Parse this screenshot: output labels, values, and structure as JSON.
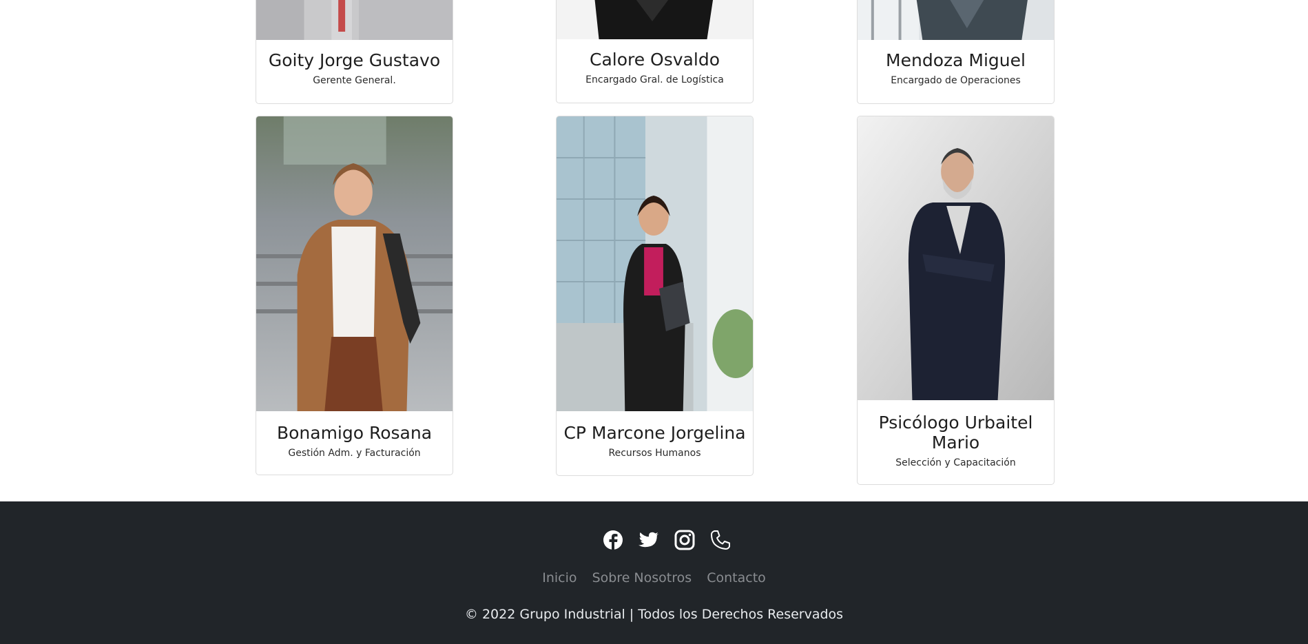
{
  "team": [
    {
      "name": "Goity Jorge Gustavo",
      "role": "Gerente General."
    },
    {
      "name": "Calore Osvaldo",
      "role": "Encargado Gral. de Logística"
    },
    {
      "name": "Mendoza Miguel",
      "role": "Encargado de Operaciones"
    },
    {
      "name": "Bonamigo Rosana",
      "role": "Gestión Adm. y Facturación"
    },
    {
      "name": "CP Marcone Jorgelina",
      "role": "Recursos Humanos"
    },
    {
      "name": "Psicólogo Urbaitel Mario",
      "role": "Selección y Capacitación"
    }
  ],
  "footer": {
    "social_icons": [
      "facebook-icon",
      "twitter-icon",
      "instagram-icon",
      "phone-icon"
    ],
    "nav": [
      "Inicio",
      "Sobre Nosotros",
      "Contacto"
    ],
    "copyright": "© 2022 Grupo Industrial | Todos los Derechos Reservados",
    "background": "#212529",
    "link_color": "#8a8d91"
  }
}
